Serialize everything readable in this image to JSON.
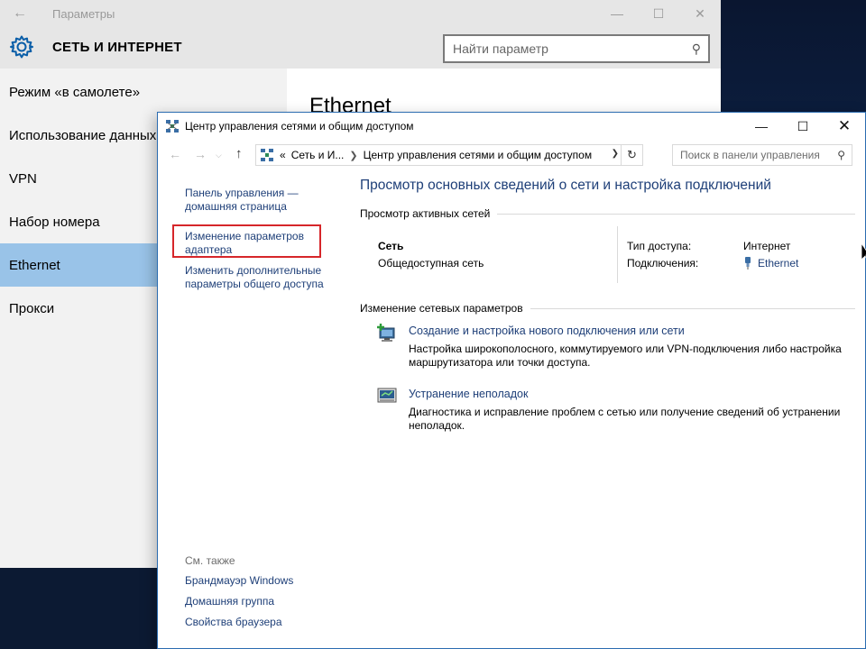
{
  "settings": {
    "window_title": "Параметры",
    "section_title": "СЕТЬ И ИНТЕРНЕТ",
    "search_placeholder": "Найти параметр",
    "content_title": "Ethernet",
    "nav": [
      {
        "label": "Режим «в самолете»",
        "active": false
      },
      {
        "label": "Использование данных",
        "active": false
      },
      {
        "label": "VPN",
        "active": false
      },
      {
        "label": "Набор номера",
        "active": false
      },
      {
        "label": "Ethernet",
        "active": true
      },
      {
        "label": "Прокси",
        "active": false
      }
    ]
  },
  "control_panel": {
    "window_title": "Центр управления сетями и общим доступом",
    "address": {
      "prefix": "«",
      "crumb1": "Сеть и И...",
      "crumb2": "Центр управления сетями и общим доступом"
    },
    "search_placeholder": "Поиск в панели управления",
    "sidebar": {
      "home_link": "Панель управления — домашняя страница",
      "adapter_link": "Изменение параметров адаптера",
      "sharing_link": "Изменить дополнительные параметры общего доступа",
      "see_also_title": "См. также",
      "see_also": [
        "Брандмауэр Windows",
        "Домашняя группа",
        "Свойства браузера"
      ]
    },
    "main": {
      "title": "Просмотр основных сведений о сети и настройка подключений",
      "active_networks_header": "Просмотр активных сетей",
      "network_name": "Сеть",
      "network_type": "Общедоступная сеть",
      "access_type_label": "Тип доступа:",
      "access_type_value": "Интернет",
      "connections_label": "Подключения:",
      "connections_value": "Ethernet",
      "change_settings_header": "Изменение сетевых параметров",
      "tasks": [
        {
          "link": "Создание и настройка нового подключения или сети",
          "desc": "Настройка широкополосного, коммутируемого или VPN-подключения либо настройка маршрутизатора или точки доступа."
        },
        {
          "link": "Устранение неполадок",
          "desc": "Диагностика и исправление проблем с сетью или получение сведений об устранении неполадок."
        }
      ]
    }
  },
  "colors": {
    "accent_link": "#1e3f78",
    "nav_active": "#99c3e8",
    "highlight": "#d6262a",
    "settings_accent": "#0a5ea8"
  }
}
